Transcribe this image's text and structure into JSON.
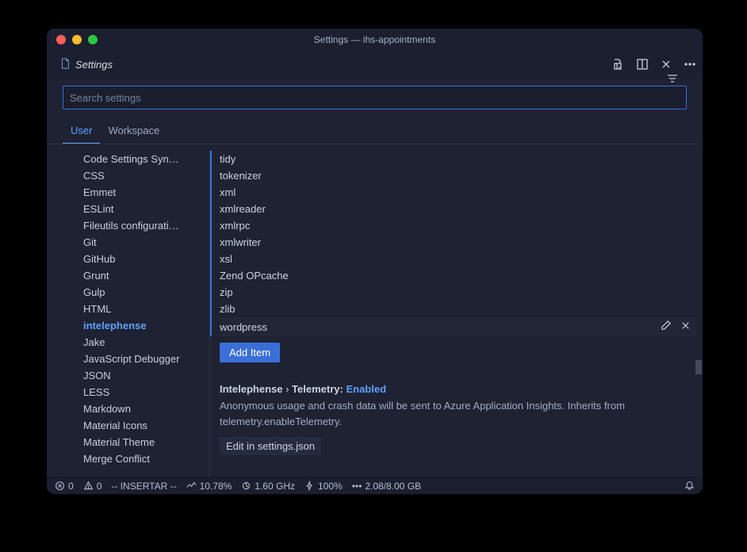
{
  "window": {
    "title": "Settings — ihs-appointments"
  },
  "tab": {
    "label": "Settings"
  },
  "search": {
    "placeholder": "Search settings"
  },
  "scope_tabs": {
    "user": "User",
    "workspace": "Workspace",
    "active": "user"
  },
  "sidebar": {
    "items": [
      "Code Settings Syn…",
      "CSS",
      "Emmet",
      "ESLint",
      "Fileutils configurati…",
      "Git",
      "GitHub",
      "Grunt",
      "Gulp",
      "HTML",
      "intelephense",
      "Jake",
      "JavaScript Debugger",
      "JSON",
      "LESS",
      "Markdown",
      "Material Icons",
      "Material Theme",
      "Merge Conflict"
    ],
    "active_index": 10
  },
  "stubs": {
    "items": [
      "tidy",
      "tokenizer",
      "xml",
      "xmlreader",
      "xmlrpc",
      "xmlwriter",
      "xsl",
      "Zend OPcache",
      "zip",
      "zlib",
      "wordpress"
    ],
    "add_label": "Add Item"
  },
  "setting": {
    "path_prefix": "Intelephense",
    "path_mid": "Telemetry:",
    "path_value": "Enabled",
    "description": "Anonymous usage and crash data will be sent to Azure Application Insights. Inherits from telemetry.enableTelemetry.",
    "edit_label": "Edit in settings.json"
  },
  "status": {
    "errors": "0",
    "warnings": "0",
    "mode": "-- INSERTAR --",
    "cpu_pct": "10.78%",
    "cpu_ghz": "1.60 GHz",
    "battery": "100%",
    "mem": "2.08/8.00 GB"
  }
}
